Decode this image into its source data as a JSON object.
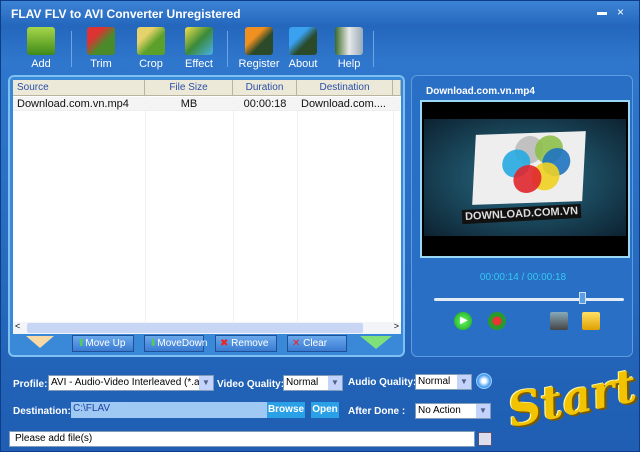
{
  "window": {
    "title": "FLAV FLV to AVI Converter Unregistered",
    "minimize": "▬",
    "close": "×"
  },
  "toolbar": [
    {
      "label": "Add",
      "icon": "add-icon"
    },
    {
      "label": "Trim",
      "icon": "scissors-icon"
    },
    {
      "label": "Crop",
      "icon": "crop-icon"
    },
    {
      "label": "Effect",
      "icon": "effect-icon"
    },
    {
      "label": "Register",
      "icon": "register-icon"
    },
    {
      "label": "About",
      "icon": "info-icon"
    },
    {
      "label": "Help",
      "icon": "help-book-icon"
    }
  ],
  "list": {
    "columns": [
      "Source",
      "File Size",
      "Duration",
      "Destination"
    ],
    "rows": [
      {
        "source": "Download.com.vn.mp4",
        "size": "MB",
        "duration": "00:00:18",
        "destination": "Download.com...."
      }
    ],
    "buttons": {
      "move_up": "Move Up",
      "move_down": "MoveDown",
      "remove": "Remove",
      "clear": "Clear"
    }
  },
  "preview": {
    "filename": "Download.com.vn.mp4",
    "logo_text": "DOWNLOAD.COM.VN",
    "time": "00:00:14 / 00:00:18",
    "progress": 0.78
  },
  "settings": {
    "profile_label": "Profile:",
    "profile": "AVI - Audio-Video Interleaved (*.avi)",
    "video_quality_label": "Video Quality:",
    "video_quality": "Normal",
    "audio_quality_label": "Audio Quality:",
    "audio_quality": "Normal",
    "destination_label": "Destination:",
    "destination": "C:\\FLAV",
    "browse": "Browse",
    "open": "Open",
    "after_done_label": "After  Done :",
    "after_done": "No Action"
  },
  "status": "Please  add  file(s)",
  "start_label": "Start"
}
